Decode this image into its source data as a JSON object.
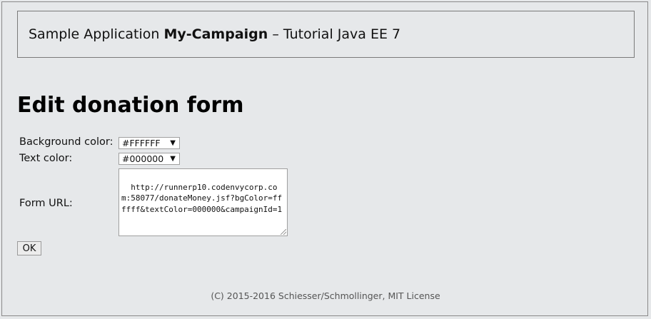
{
  "header": {
    "prefix": "Sample Application ",
    "app_name": "My-Campaign",
    "suffix": " – Tutorial Java EE 7"
  },
  "page": {
    "title": "Edit donation form"
  },
  "form": {
    "background_color": {
      "label": "Background color:",
      "value": "#FFFFFF"
    },
    "text_color": {
      "label": "Text color:",
      "value": "#000000"
    },
    "form_url": {
      "label": "Form URL:",
      "value": "http://runnerp10.codenvycorp.com:58077/donateMoney.jsf?bgColor=ffffff&textColor=000000&campaignId=1"
    },
    "ok_label": "OK"
  },
  "footer": {
    "text": "(C) 2015-2016 Schiesser/Schmollinger, MIT License"
  },
  "icons": {
    "dropdown": "chevron-down-icon",
    "resize": "resize-grip-icon"
  }
}
